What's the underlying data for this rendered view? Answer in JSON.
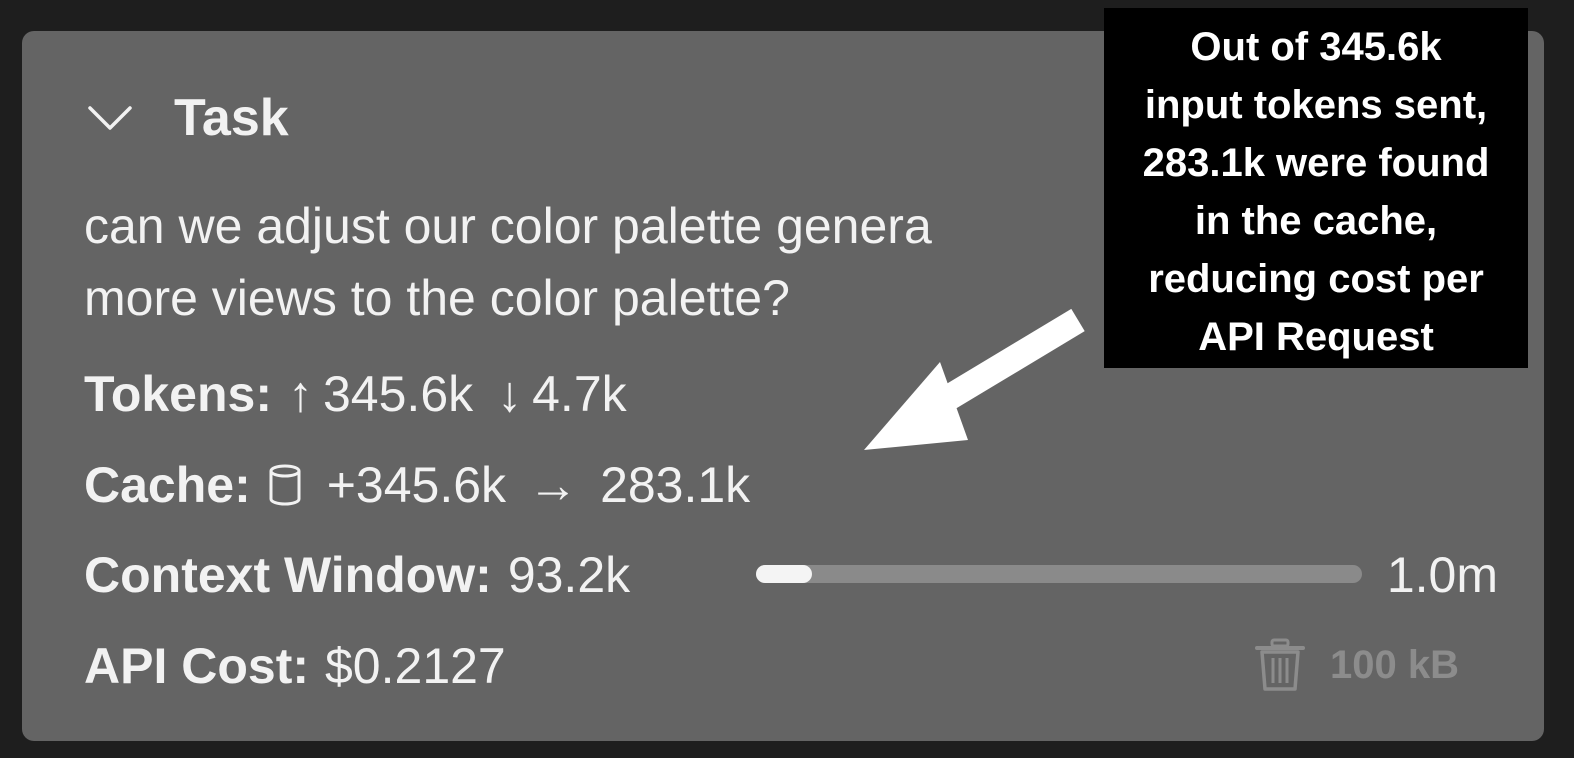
{
  "task": {
    "title": "Task",
    "description_lines": [
      "can we adjust our color palette genera",
      "more views to the color palette?"
    ]
  },
  "stats": {
    "tokens": {
      "label": "Tokens:",
      "up_arrow": "↑",
      "input": "345.6k",
      "down_arrow": "↓",
      "output": "4.7k"
    },
    "cache": {
      "label": "Cache:",
      "icon": "cylinder-icon",
      "writes": "+345.6k",
      "arrow": "→",
      "reads": "283.1k"
    },
    "context_window": {
      "label": "Context Window:",
      "used": "93.2k",
      "max": "1.0m",
      "fill_fraction": 0.093
    },
    "api_cost": {
      "label": "API Cost:",
      "value": "$0.2127"
    }
  },
  "storage": {
    "icon": "trash-icon",
    "size": "100 kB"
  },
  "annotation": {
    "lines": [
      "Out of 345.6k",
      "input tokens sent,",
      "283.1k were found",
      "in the cache,",
      "reducing cost per",
      "API Request"
    ]
  },
  "colors": {
    "panel": "#646464",
    "background": "#1e1e1e",
    "text": "#f2f2f2",
    "callout": "#000000"
  }
}
